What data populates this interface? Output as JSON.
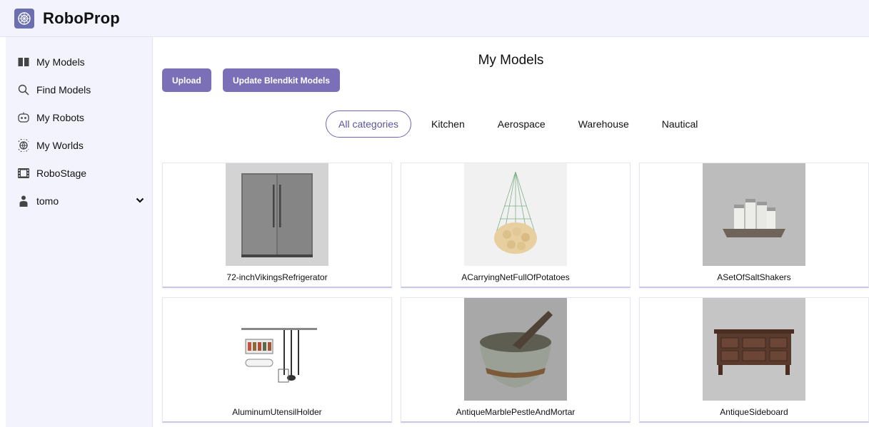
{
  "app": {
    "name": "RoboProp",
    "logo_icon": "robot-logo-icon"
  },
  "sidebar": {
    "items": [
      {
        "label": "My Models",
        "icon": "book-icon"
      },
      {
        "label": "Find Models",
        "icon": "search-icon"
      },
      {
        "label": "My Robots",
        "icon": "robot-head-icon"
      },
      {
        "label": "My Worlds",
        "icon": "globe-icon"
      },
      {
        "label": "RoboStage",
        "icon": "film-icon"
      },
      {
        "label": "tomo",
        "icon": "user-icon"
      }
    ]
  },
  "main": {
    "title": "My Models",
    "buttons": {
      "upload": "Upload",
      "update": "Update Blendkit Models"
    },
    "categories": [
      "All categories",
      "Kitchen",
      "Aerospace",
      "Warehouse",
      "Nautical"
    ],
    "active_category": "All categories",
    "models": [
      {
        "name": "72-inchVikingsRefrigerator"
      },
      {
        "name": "ACarryingNetFullOfPotatoes"
      },
      {
        "name": "ASetOfSaltShakers"
      },
      {
        "name": "AluminumUtensilHolder"
      },
      {
        "name": "AntiqueMarblePestleAndMortar"
      },
      {
        "name": "AntiqueSideboard"
      }
    ]
  },
  "colors": {
    "accent": "#7b6fb8",
    "sidebar_bg": "#f2f3fc"
  }
}
